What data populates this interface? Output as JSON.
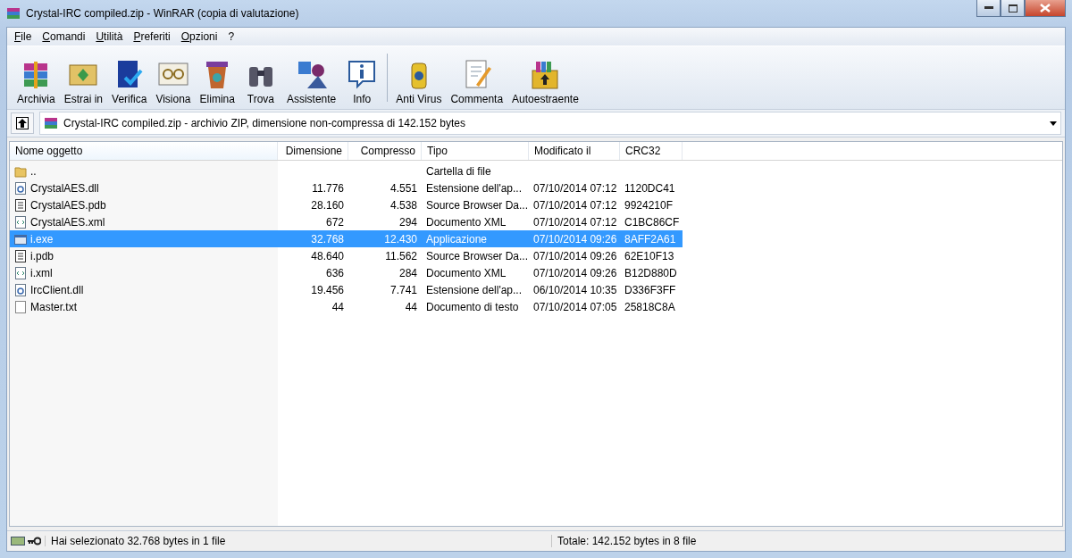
{
  "window": {
    "title": "Crystal-IRC compiled.zip - WinRAR (copia di valutazione)"
  },
  "menu": [
    "File",
    "Comandi",
    "Utilità",
    "Preferiti",
    "Opzioni",
    "?"
  ],
  "toolbar": [
    {
      "label": "Archivia"
    },
    {
      "label": "Estrai in"
    },
    {
      "label": "Verifica"
    },
    {
      "label": "Visiona"
    },
    {
      "label": "Elimina"
    },
    {
      "label": "Trova"
    },
    {
      "label": "Assistente"
    },
    {
      "label": "Info"
    },
    {
      "label": "Anti Virus"
    },
    {
      "label": "Commenta"
    },
    {
      "label": "Autoestraente"
    }
  ],
  "address": {
    "text": "Crystal-IRC compiled.zip - archivio ZIP, dimensione non-compressa di 142.152 bytes"
  },
  "table": {
    "columns": [
      "Nome oggetto",
      "Dimensione",
      "Compresso",
      "Tipo",
      "Modificato il",
      "CRC32"
    ],
    "rows": [
      {
        "kind": "folder",
        "selected": false,
        "cells": [
          "..",
          "",
          "",
          "Cartella di file",
          "",
          ""
        ]
      },
      {
        "kind": "dll",
        "selected": false,
        "cells": [
          "CrystalAES.dll",
          "11.776",
          "4.551",
          "Estensione dell'ap...",
          "07/10/2014 07:12",
          "1120DC41"
        ]
      },
      {
        "kind": "doc",
        "selected": false,
        "cells": [
          "CrystalAES.pdb",
          "28.160",
          "4.538",
          "Source Browser Da...",
          "07/10/2014 07:12",
          "9924210F"
        ]
      },
      {
        "kind": "xml",
        "selected": false,
        "cells": [
          "CrystalAES.xml",
          "672",
          "294",
          "Documento XML",
          "07/10/2014 07:12",
          "C1BC86CF"
        ]
      },
      {
        "kind": "exe",
        "selected": true,
        "cells": [
          "i.exe",
          "32.768",
          "12.430",
          "Applicazione",
          "07/10/2014 09:26",
          "8AFF2A61"
        ]
      },
      {
        "kind": "doc",
        "selected": false,
        "cells": [
          "i.pdb",
          "48.640",
          "11.562",
          "Source Browser Da...",
          "07/10/2014 09:26",
          "62E10F13"
        ]
      },
      {
        "kind": "xml",
        "selected": false,
        "cells": [
          "i.xml",
          "636",
          "284",
          "Documento XML",
          "07/10/2014 09:26",
          "B12D880D"
        ]
      },
      {
        "kind": "dll",
        "selected": false,
        "cells": [
          "IrcClient.dll",
          "19.456",
          "7.741",
          "Estensione dell'ap...",
          "06/10/2014 10:35",
          "D336F3FF"
        ]
      },
      {
        "kind": "txt",
        "selected": false,
        "cells": [
          "Master.txt",
          "44",
          "44",
          "Documento di testo",
          "07/10/2014 07:05",
          "25818C8A"
        ]
      }
    ]
  },
  "status_bar": {
    "left": "Hai selezionato 32.768 bytes in 1 file",
    "right": "Totale: 142.152 bytes in 8 file"
  }
}
